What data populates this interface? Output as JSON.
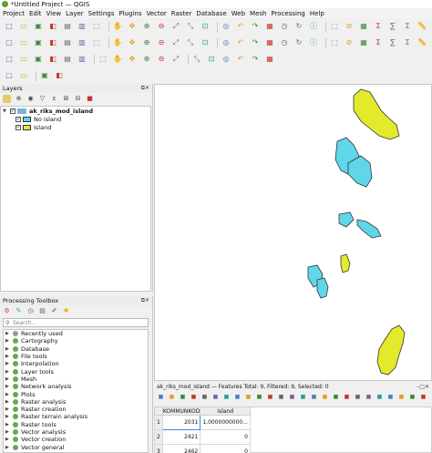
{
  "window": {
    "title": "*Untitled Project — QGIS"
  },
  "menu": [
    "Project",
    "Edit",
    "View",
    "Layer",
    "Settings",
    "Plugins",
    "Vector",
    "Raster",
    "Database",
    "Web",
    "Mesh",
    "Processing",
    "Help"
  ],
  "toolbar1": [
    "new-project-icon",
    "open-project-icon",
    "save-project-icon",
    "save-as-icon",
    "print-layout-icon",
    "layout-manager-icon",
    "style-manager-icon",
    "pan-icon",
    "pan-to-selection-icon",
    "zoom-in-icon",
    "zoom-out-icon",
    "zoom-full-icon",
    "zoom-selection-icon",
    "zoom-layer-icon",
    "zoom-native-icon",
    "zoom-last-icon",
    "zoom-next-icon",
    "new-map-view-icon",
    "temporal-icon",
    "refresh-icon",
    "identify-icon",
    "select-icon",
    "deselect-icon",
    "open-table-icon",
    "statistics-icon",
    "calculator-icon",
    "sum-icon",
    "measure-icon"
  ],
  "toolbar2": [
    "data-source-manager-icon",
    "new-geopackage-icon",
    "new-shapefile-icon",
    "new-spatialite-icon",
    "new-virtual-layer-icon",
    "digitize-icon",
    "edit-icon",
    "save-edits-icon",
    "add-feature-icon",
    "vertex-tool-icon",
    "delete-icon",
    "cut-icon",
    "copy-icon",
    "paste-icon",
    "undo-icon",
    "redo-icon",
    "label-icon",
    "pin-label-icon",
    "show-label-icon",
    "move-label-icon",
    "rotate-label-icon",
    "label-props-icon",
    "db-icon",
    "python-icon",
    "plugin-icon",
    "spectacles-icon",
    "glasses-icon",
    "vertex-icon"
  ],
  "toolbar3": [
    "gps-icon",
    "advanced-digitize-icon",
    "snapping-icon",
    "topology-icon",
    "offset-icon",
    "reshape-icon",
    "split-icon",
    "merge-icon",
    "rotate-icon",
    "simplify-icon",
    "add-ring-icon",
    "delete-ring-icon",
    "fill-ring-icon",
    "offset-curve-icon",
    "split-parts-icon",
    "annotation-icon",
    "text-annotation-icon",
    "form-annotation-icon"
  ],
  "toolbar4": [
    "cad-icon",
    "georef-icon",
    "grass-icon",
    "scale-icon"
  ],
  "layers_panel": {
    "title": "Layers",
    "layer_name": "ak_riks_mod_island",
    "classes": [
      {
        "label": "No island",
        "color": "#5fd7e8"
      },
      {
        "label": "Island",
        "color": "#e3ea2c"
      }
    ]
  },
  "toolbox": {
    "title": "Processing Toolbox",
    "search_placeholder": "Search...",
    "items": [
      "Recently used",
      "Cartography",
      "Database",
      "File tools",
      "Interpolation",
      "Layer tools",
      "Mesh",
      "Network analysis",
      "Plots",
      "Raster analysis",
      "Raster creation",
      "Raster terrain analysis",
      "Raster tools",
      "Vector analysis",
      "Vector creation",
      "Vector general"
    ]
  },
  "attribute_table": {
    "title": "ak_riks_mod_island — Features Total: 9, Filtered: 9, Selected: 0",
    "columns": [
      "KOMMUNKOD",
      "island"
    ],
    "rows": [
      {
        "n": "1",
        "kommunkod": "2031",
        "island": "1,0000000000..."
      },
      {
        "n": "2",
        "kommunkod": "2421",
        "island": "0"
      },
      {
        "n": "3",
        "kommunkod": "2462",
        "island": "0"
      }
    ]
  },
  "colors": {
    "no_island": "#5fd7e8",
    "island": "#e3ea2c",
    "outline": "#333333"
  }
}
